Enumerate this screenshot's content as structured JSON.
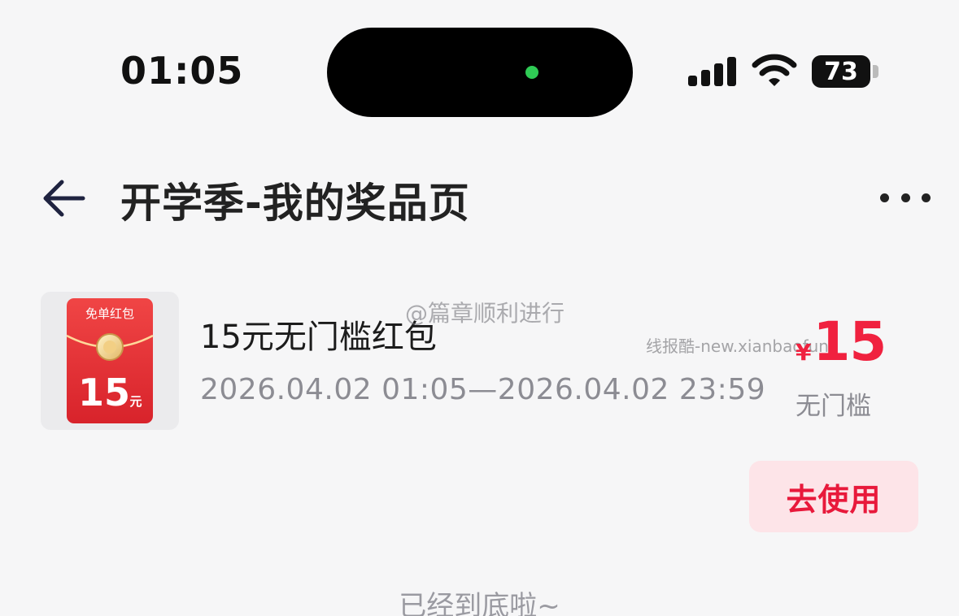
{
  "status_bar": {
    "time": "01:05",
    "battery_level": "73",
    "signal_icon": "cellular-signal-icon",
    "wifi_icon": "wifi-icon",
    "indicator_color": "#2fcb55"
  },
  "nav": {
    "back_icon": "back-arrow-icon",
    "title": "开学季-我的奖品页",
    "more_icon": "more-dots-icon"
  },
  "coupon": {
    "thumb": {
      "header": "免单红包",
      "amount": "15",
      "unit": "元"
    },
    "title": "15元无门槛红包",
    "period": "2026.04.02 01:05—2026.04.02 23:59",
    "currency_symbol": "¥",
    "amount": "15",
    "condition": "无门槛",
    "action_label": "去使用",
    "accent_color": "#f0213f"
  },
  "watermarks": {
    "weibo": "@篇章顺利进行",
    "site": "线报酷-new.xianbaofun"
  },
  "footer": {
    "end_text": "已经到底啦~"
  }
}
